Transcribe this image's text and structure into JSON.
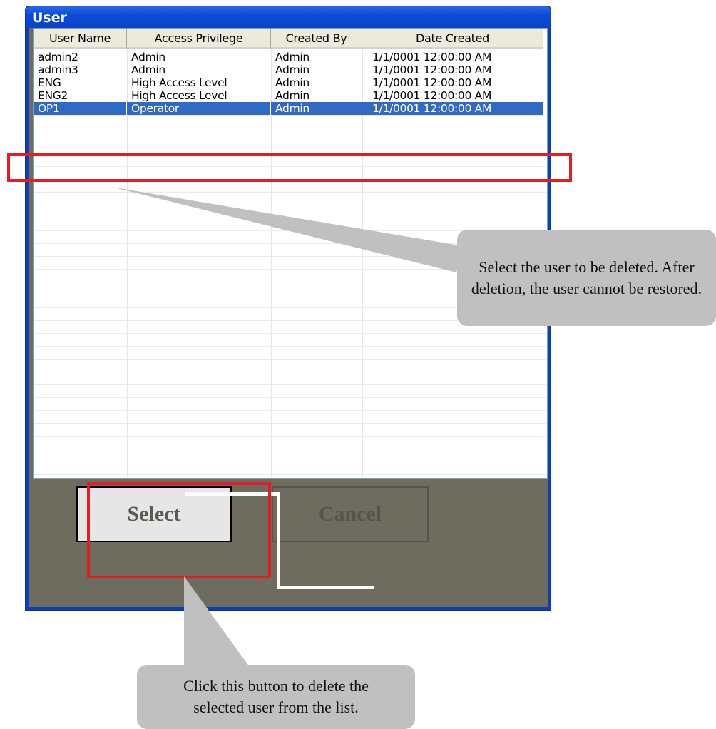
{
  "window": {
    "title": "User"
  },
  "table": {
    "columns": [
      "User Name",
      "Access Privilege",
      "Created By",
      "Date Created"
    ],
    "rows": [
      [
        "admin2",
        "Admin",
        "Admin",
        "1/1/0001 12:00:00 AM"
      ],
      [
        "admin3",
        "Admin",
        "Admin",
        "1/1/0001 12:00:00 AM"
      ],
      [
        "ENG",
        "High Access Level",
        "Admin",
        "1/1/0001 12:00:00 AM"
      ],
      [
        "ENG2",
        "High Access Level",
        "Admin",
        "1/1/0001 12:00:00 AM"
      ],
      [
        "OP1",
        "Operator",
        "Admin",
        "1/1/0001 12:00:00 AM"
      ]
    ],
    "selected_row": "OP1"
  },
  "buttons": {
    "select_label": "Select",
    "cancel_label": "Cancel"
  },
  "callouts": {
    "list_note": "Select the user to be deleted. After deletion, the user cannot be restored.",
    "button_note": "Click this button to delete the selected user from the list."
  },
  "colors": {
    "highlight": "#316ac5",
    "annotation_red": "#e51c23",
    "callout_gray": "#c0c0c0",
    "titlebar_blue": "#0a43c9"
  }
}
